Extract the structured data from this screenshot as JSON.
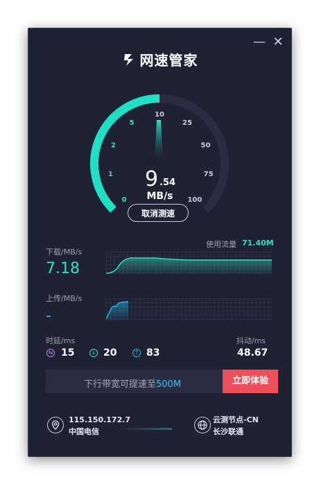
{
  "app": {
    "title": "网速管家"
  },
  "window_controls": {
    "minimize": "—",
    "close": "✕"
  },
  "gauge": {
    "ticks": [
      "0",
      "1",
      "2",
      "5",
      "10",
      "25",
      "50",
      "75",
      "100"
    ],
    "speed_int": "9",
    "speed_dec": ".54",
    "unit": "MB/s",
    "cancel_label": "取消测速",
    "progress": 0.5,
    "colors": {
      "active": "#1fe0c4",
      "inactive": "#2a2d42",
      "tick_active": "#2fe0c4",
      "tick_inactive": "#c9ccd8"
    }
  },
  "download": {
    "label": "下载/MB/s",
    "value": "7.18"
  },
  "usage": {
    "label": "使用流量",
    "value": "71.40M"
  },
  "upload": {
    "label": "上传/MB/s",
    "value": "-"
  },
  "latency": {
    "label": "时延/ms",
    "ping": "15",
    "down": "20",
    "up": "83"
  },
  "jitter": {
    "label": "抖动/ms",
    "value": "48.67"
  },
  "banner": {
    "text_prefix": "下行带宽可提速至",
    "highlight": "500M",
    "button": "立即体验"
  },
  "footer": {
    "ip": "115.150.172.7",
    "isp": "中国电信",
    "node": "云测节点-CN",
    "node_isp": "长沙联通"
  }
}
